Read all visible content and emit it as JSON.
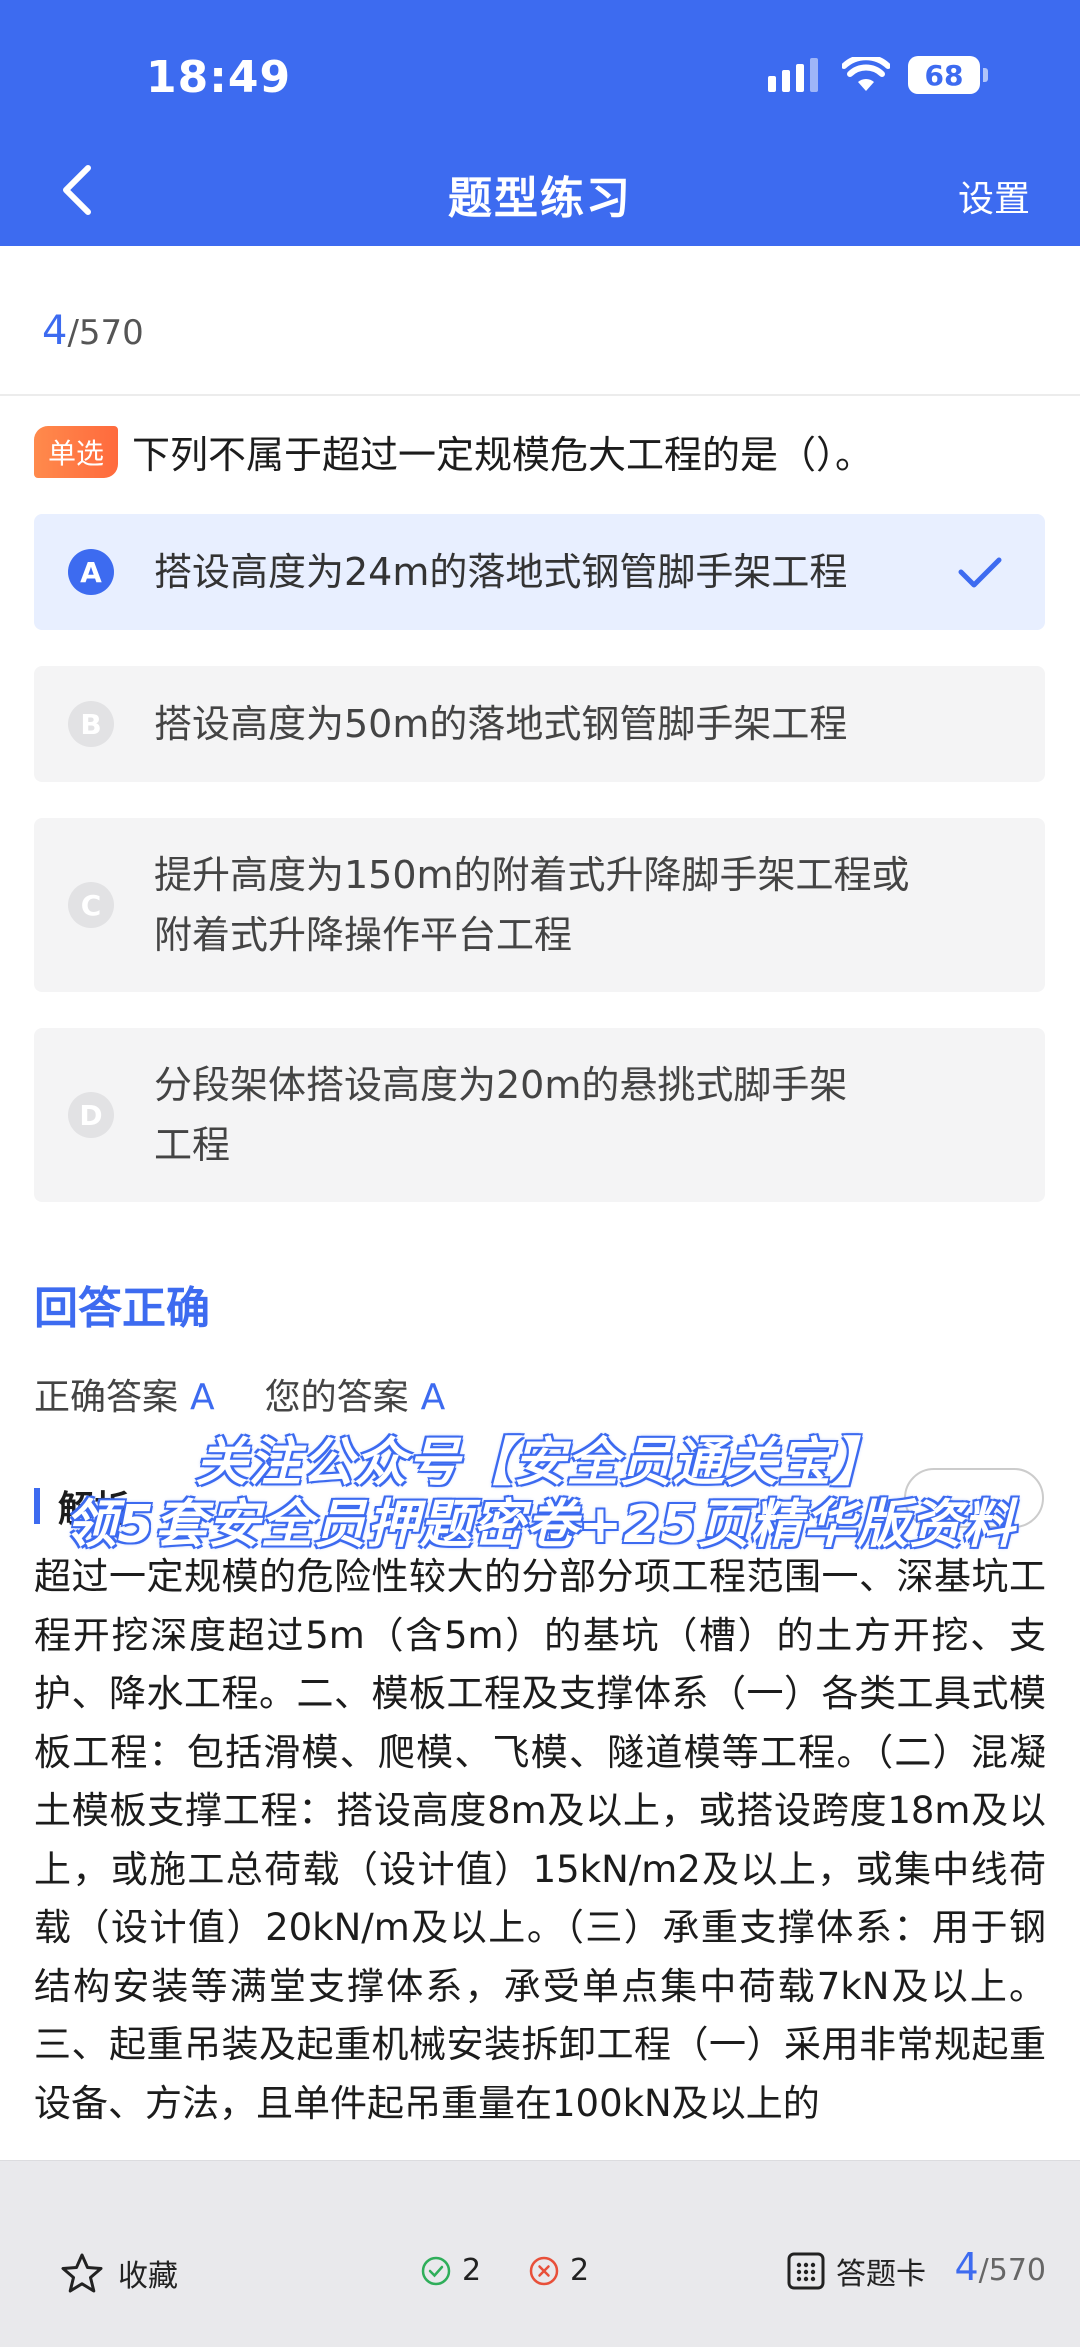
{
  "status": {
    "time": "18:49",
    "battery": "68"
  },
  "header": {
    "title": "题型练习",
    "settings": "设置"
  },
  "progress": {
    "current": "4",
    "total": "/570"
  },
  "question": {
    "type": "单选",
    "text": "下列不属于超过一定规模危大工程的是（）。",
    "options": [
      {
        "letter": "A",
        "text": "搭设高度为24m的落地式钢管脚手架工程",
        "selected": true
      },
      {
        "letter": "B",
        "text": "搭设高度为50m的落地式钢管脚手架工程",
        "selected": false
      },
      {
        "letter": "C",
        "text": "提升高度为150m的附着式升降脚手架工程或附着式升降操作平台工程",
        "selected": false
      },
      {
        "letter": "D",
        "text": "分段架体搭设高度为20m的悬挑式脚手架工程",
        "selected": false
      }
    ]
  },
  "result": {
    "title": "回答正确",
    "correct_label": "正确答案",
    "correct_value": "A",
    "yours_label": "您的答案",
    "yours_value": "A"
  },
  "analysis": {
    "label": "解析",
    "text": "超过一定规模的危险性较大的分部分项工程范围一、深基坑工程开挖深度超过5m（含5m）的基坑（槽）的土方开挖、支护、降水工程。二、模板工程及支撑体系（一）各类工具式模板工程：包括滑模、爬模、飞模、隧道模等工程。（二）混凝土模板支撑工程：搭设高度8m及以上，或搭设跨度18m及以上，或施工总荷载（设计值）15kN/m2及以上，或集中线荷载（设计值）20kN/m及以上。（三）承重支撑体系：用于钢结构安装等满堂支撑体系，承受单点集中荷载7kN及以上。三、起重吊装及起重机械安装拆卸工程（一）采用非常规起重设备、方法，且单件起吊重量在100kN及以上的"
  },
  "watermark": {
    "line1": "关注公众号【安全员通关宝】",
    "line2": "领5套安全员押题密卷+25页精华版资料"
  },
  "bottom": {
    "favorite": "收藏",
    "correct_count": "2",
    "wrong_count": "2",
    "answer_card": "答题卡",
    "current": "4",
    "total": "/570"
  },
  "colors": {
    "accent": "#3d6bf0",
    "tag": "#ff7a45",
    "correct": "#2fae5a",
    "wrong": "#e8503a"
  }
}
